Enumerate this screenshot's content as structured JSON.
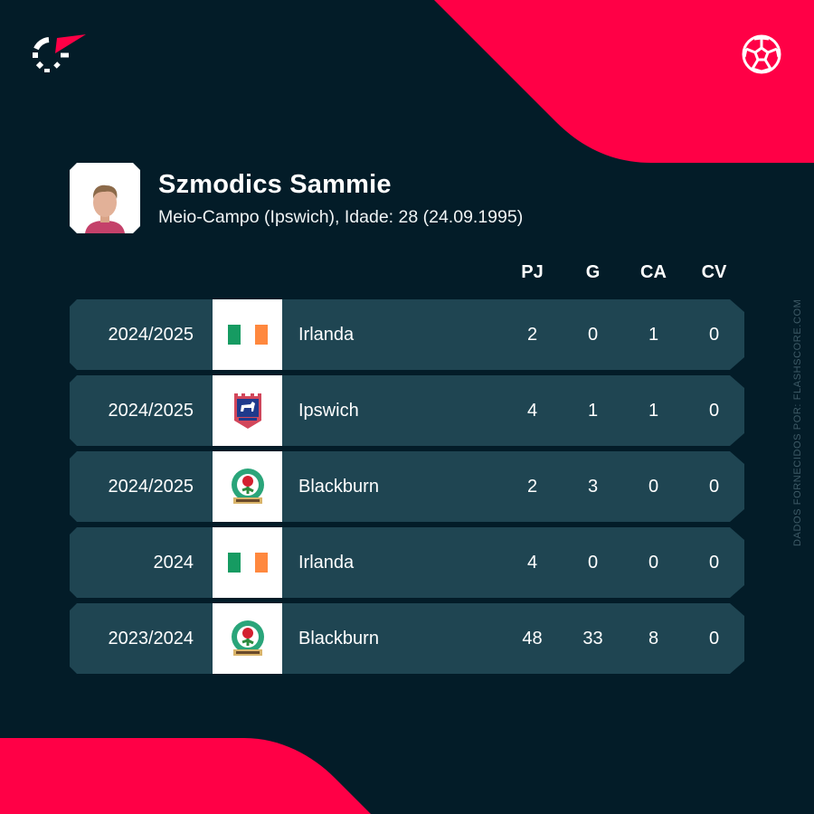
{
  "brand": {
    "logo_icon": "flashscore-logo-icon",
    "sport_icon": "soccer-ball-icon",
    "colors": {
      "background": "#031c28",
      "accent": "#ff0046",
      "row": "#1f4552",
      "text": "#ffffff",
      "credit": "#3e5a66"
    }
  },
  "player": {
    "name": "Szmodics Sammie",
    "info": "Meio-Campo (Ipswich), Idade: 28 (24.09.1995)",
    "avatar_icon": "player-photo"
  },
  "table": {
    "columns": [
      "PJ",
      "G",
      "CA",
      "CV"
    ],
    "rows": [
      {
        "season": "2024/2025",
        "team": "Irlanda",
        "logo": "ireland-flag-icon",
        "stats": [
          "2",
          "0",
          "1",
          "0"
        ]
      },
      {
        "season": "2024/2025",
        "team": "Ipswich",
        "logo": "ipswich-crest-icon",
        "stats": [
          "4",
          "1",
          "1",
          "0"
        ]
      },
      {
        "season": "2024/2025",
        "team": "Blackburn",
        "logo": "blackburn-crest-icon",
        "stats": [
          "2",
          "3",
          "0",
          "0"
        ]
      },
      {
        "season": "2024",
        "team": "Irlanda",
        "logo": "ireland-flag-icon",
        "stats": [
          "4",
          "0",
          "0",
          "0"
        ]
      },
      {
        "season": "2023/2024",
        "team": "Blackburn",
        "logo": "blackburn-crest-icon",
        "stats": [
          "48",
          "33",
          "8",
          "0"
        ]
      }
    ]
  },
  "credit": "DADOS FORNECIDOS POR: FLASHSCORE.COM"
}
